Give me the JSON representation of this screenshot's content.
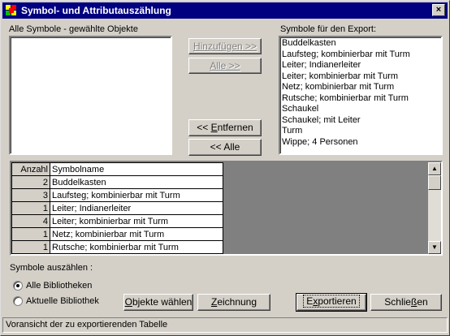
{
  "window": {
    "title": "Symbol- und Attributauszählung",
    "close_glyph": "×"
  },
  "left_list": {
    "label": "Alle Symbole - gewählte Objekte",
    "items": []
  },
  "right_list": {
    "label": "Symbole für den Export:",
    "items": [
      "Buddelkasten",
      "Laufsteg; kombinierbar mit Turm",
      "Leiter; Indianerleiter",
      "Leiter; kombinierbar mit Turm",
      "Netz; kombinierbar mit Turm",
      "Rutsche; kombinierbar mit Turm",
      "Schaukel",
      "Schaukel; mit Leiter",
      "Turm",
      "Wippe; 4 Personen"
    ]
  },
  "buttons": {
    "add": "Hinzufügen >>",
    "all_right": "Alle >>",
    "remove_prefix": "<< ",
    "remove_key": "E",
    "remove_rest": "ntfernen",
    "all_left": "<< Alle",
    "select_objects_key": "O",
    "select_objects_rest": "bjekte wählen",
    "drawing_key": "Z",
    "drawing_rest": "eichnung",
    "export_key": "x",
    "export_pre": "E",
    "export_rest": "portieren",
    "close_pre": "Schlie",
    "close_key": "ß",
    "close_rest": "en"
  },
  "table": {
    "headers": [
      "Anzahl",
      "Symbolname"
    ],
    "rows": [
      {
        "count": "2",
        "name": "Buddelkasten"
      },
      {
        "count": "3",
        "name": "Laufsteg; kombinierbar mit Turm"
      },
      {
        "count": "1",
        "name": "Leiter; Indianerleiter"
      },
      {
        "count": "4",
        "name": "Leiter; kombinierbar mit Turm"
      },
      {
        "count": "1",
        "name": "Netz; kombinierbar mit Turm"
      },
      {
        "count": "1",
        "name": "Rutsche; kombinierbar mit Turm"
      }
    ],
    "scroll_up": "▲",
    "scroll_down": "▼"
  },
  "count_options": {
    "label": "Symbole auszählen :",
    "options": [
      {
        "label": "Alle Bibliotheken",
        "selected": true
      },
      {
        "label": "Aktuelle Bibliothek",
        "selected": false
      }
    ]
  },
  "status": {
    "text": "Voransicht der zu exportierenden Tabelle"
  },
  "colors": {
    "titlebar": "#000080",
    "face": "#d4d0c8"
  }
}
